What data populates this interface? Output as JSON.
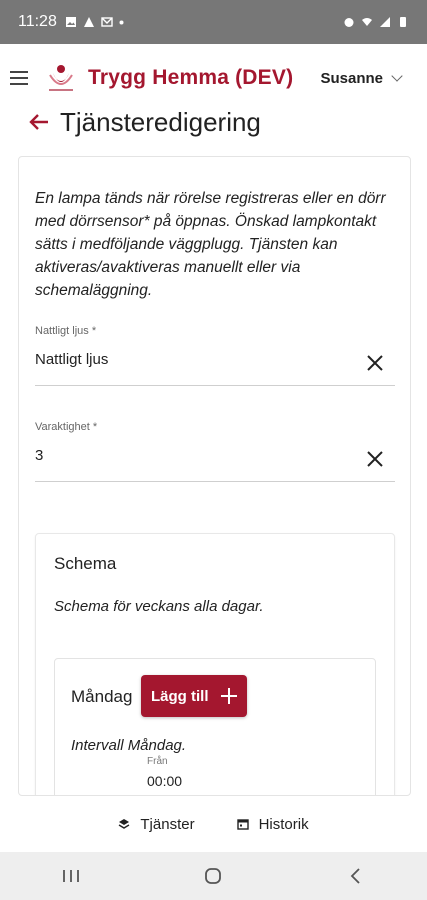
{
  "status_bar": {
    "time": "11:28"
  },
  "app": {
    "title": "Trygg Hemma (DEV)",
    "user": "Susanne"
  },
  "page": {
    "title": "Tjänsteredigering"
  },
  "description": "En lampa tänds när rörelse registreras eller en dörr med dörrsensor* på öppnas. Önskad lampkontakt sätts i medföljande väggplugg. Tjänsten kan aktiveras/avaktiveras manuellt eller via schemaläggning.",
  "fields": {
    "name": {
      "label": "Nattligt ljus *",
      "value": "Nattligt ljus"
    },
    "duration": {
      "label": "Varaktighet *",
      "value": "3"
    }
  },
  "schema": {
    "title": "Schema",
    "description": "Schema för veckans alla dagar.",
    "day": {
      "name": "Måndag",
      "add_label": "Lägg till",
      "interval": "Intervall Måndag.",
      "from_label": "Från",
      "from_value": "00:00"
    }
  },
  "bottom_nav": {
    "services": "Tjänster",
    "history": "Historik"
  },
  "colors": {
    "brand": "#a4172f"
  },
  "icons": [
    "menu-icon",
    "logo-icon",
    "chevron-down-icon",
    "back-arrow-icon",
    "close-icon",
    "plus-icon",
    "layers-icon",
    "calendar-icon"
  ]
}
